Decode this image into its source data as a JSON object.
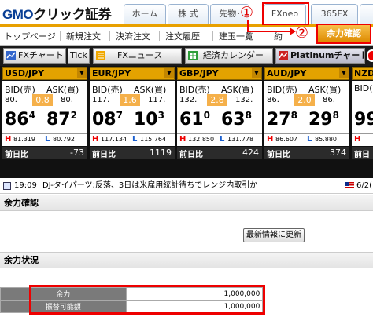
{
  "header": {
    "logo_brand": "GMO",
    "logo_text": "クリック証券",
    "tabs": [
      {
        "label": "ホーム"
      },
      {
        "label": "株 式"
      },
      {
        "label": "先物･"
      },
      {
        "label": "FXneo"
      },
      {
        "label": "365FX"
      }
    ],
    "annotation_1": "①",
    "annotation_2": "②"
  },
  "subnav": {
    "items": [
      "トップページ",
      "新規注文",
      "決済注文",
      "注文履歴",
      "建玉一覧",
      "約"
    ],
    "yoryoku_button": "余力確認"
  },
  "toolbar": {
    "fx_chart": "FXチャート",
    "tick": "Tick",
    "fx_news": "FXニュース",
    "calendar": "経済カレンダー",
    "platinum": "Platinumチャート"
  },
  "rates": [
    {
      "pair": "USD/JPY",
      "bid_label": "BID(売)",
      "ask_label": "ASK(買)",
      "bid_small": "80.",
      "spread": "0.8",
      "ask_small": "80.",
      "bid_big": "86",
      "bid_sup": "4",
      "ask_big": "87",
      "ask_sup": "2",
      "high_label": "H",
      "high": "81.319",
      "low_label": "L",
      "low": "80.792",
      "change_label": "前日比",
      "change": "-73"
    },
    {
      "pair": "EUR/JPY",
      "bid_label": "BID(売)",
      "ask_label": "ASK(買)",
      "bid_small": "117.",
      "spread": "1.6",
      "ask_small": "117.",
      "bid_big": "08",
      "bid_sup": "7",
      "ask_big": "10",
      "ask_sup": "3",
      "high_label": "H",
      "high": "117.134",
      "low_label": "L",
      "low": "115.764",
      "change_label": "前日比",
      "change": "1119"
    },
    {
      "pair": "GBP/JPY",
      "bid_label": "BID(売)",
      "ask_label": "ASK(買)",
      "bid_small": "132.",
      "spread": "2.8",
      "ask_small": "132.",
      "bid_big": "61",
      "bid_sup": "0",
      "ask_big": "63",
      "ask_sup": "8",
      "high_label": "H",
      "high": "132.850",
      "low_label": "L",
      "low": "131.778",
      "change_label": "前日比",
      "change": "424"
    },
    {
      "pair": "AUD/JPY",
      "bid_label": "BID(売)",
      "ask_label": "ASK(買)",
      "bid_small": "86.",
      "spread": "2.0",
      "ask_small": "86.",
      "bid_big": "27",
      "bid_sup": "8",
      "ask_big": "29",
      "ask_sup": "8",
      "high_label": "H",
      "high": "86.607",
      "low_label": "L",
      "low": "85.880",
      "change_label": "前日比",
      "change": "374"
    },
    {
      "pair": "NZD/",
      "bid_label": "BID(",
      "ask_label": "",
      "bid_small": "",
      "spread": "",
      "ask_small": "",
      "bid_big": "99",
      "bid_sup": "",
      "ask_big": "",
      "ask_sup": "",
      "high_label": "H",
      "high": "",
      "low_label": "",
      "low": "",
      "change_label": "前日",
      "change": ""
    }
  ],
  "news": {
    "time": "19:09",
    "headline": "DJ-タイパーツ;反落、3日は米雇用統計待ちでレンジ内取引か",
    "date": "6/2("
  },
  "content": {
    "section1_title": "余力確認",
    "refresh_button": "最新情報に更新",
    "section2_title": "余力状況",
    "rows": [
      {
        "label": "余力",
        "value": "1,000,000"
      },
      {
        "label": "振替可能額",
        "value": "1,000,000"
      }
    ]
  },
  "colors": {
    "accent_orange": "#e3a200",
    "highlight_red": "#ee0000",
    "brand_blue": "#0a3f95"
  }
}
